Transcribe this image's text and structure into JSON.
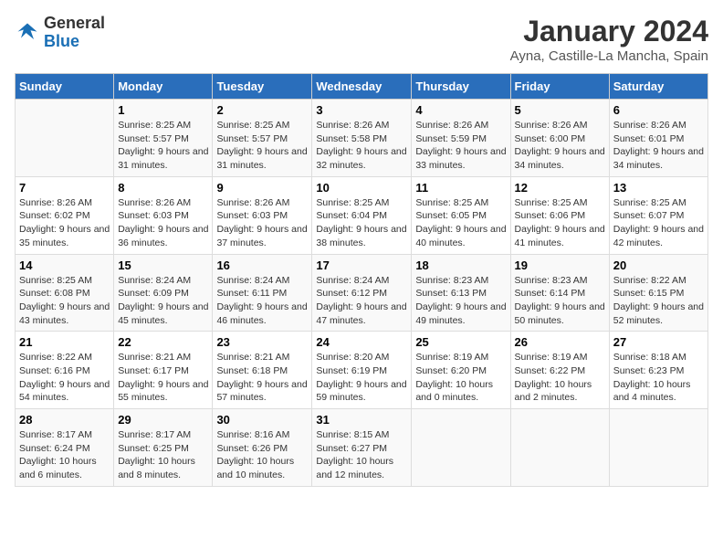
{
  "logo": {
    "general": "General",
    "blue": "Blue"
  },
  "title": "January 2024",
  "subtitle": "Ayna, Castille-La Mancha, Spain",
  "days_of_week": [
    "Sunday",
    "Monday",
    "Tuesday",
    "Wednesday",
    "Thursday",
    "Friday",
    "Saturday"
  ],
  "weeks": [
    [
      {
        "day": "",
        "info": ""
      },
      {
        "day": "1",
        "info": "Sunrise: 8:25 AM\nSunset: 5:57 PM\nDaylight: 9 hours and 31 minutes."
      },
      {
        "day": "2",
        "info": "Sunrise: 8:25 AM\nSunset: 5:57 PM\nDaylight: 9 hours and 31 minutes."
      },
      {
        "day": "3",
        "info": "Sunrise: 8:26 AM\nSunset: 5:58 PM\nDaylight: 9 hours and 32 minutes."
      },
      {
        "day": "4",
        "info": "Sunrise: 8:26 AM\nSunset: 5:59 PM\nDaylight: 9 hours and 33 minutes."
      },
      {
        "day": "5",
        "info": "Sunrise: 8:26 AM\nSunset: 6:00 PM\nDaylight: 9 hours and 34 minutes."
      },
      {
        "day": "6",
        "info": "Sunrise: 8:26 AM\nSunset: 6:01 PM\nDaylight: 9 hours and 34 minutes."
      }
    ],
    [
      {
        "day": "7",
        "info": "Sunrise: 8:26 AM\nSunset: 6:02 PM\nDaylight: 9 hours and 35 minutes."
      },
      {
        "day": "8",
        "info": "Sunrise: 8:26 AM\nSunset: 6:03 PM\nDaylight: 9 hours and 36 minutes."
      },
      {
        "day": "9",
        "info": "Sunrise: 8:26 AM\nSunset: 6:03 PM\nDaylight: 9 hours and 37 minutes."
      },
      {
        "day": "10",
        "info": "Sunrise: 8:25 AM\nSunset: 6:04 PM\nDaylight: 9 hours and 38 minutes."
      },
      {
        "day": "11",
        "info": "Sunrise: 8:25 AM\nSunset: 6:05 PM\nDaylight: 9 hours and 40 minutes."
      },
      {
        "day": "12",
        "info": "Sunrise: 8:25 AM\nSunset: 6:06 PM\nDaylight: 9 hours and 41 minutes."
      },
      {
        "day": "13",
        "info": "Sunrise: 8:25 AM\nSunset: 6:07 PM\nDaylight: 9 hours and 42 minutes."
      }
    ],
    [
      {
        "day": "14",
        "info": "Sunrise: 8:25 AM\nSunset: 6:08 PM\nDaylight: 9 hours and 43 minutes."
      },
      {
        "day": "15",
        "info": "Sunrise: 8:24 AM\nSunset: 6:09 PM\nDaylight: 9 hours and 45 minutes."
      },
      {
        "day": "16",
        "info": "Sunrise: 8:24 AM\nSunset: 6:11 PM\nDaylight: 9 hours and 46 minutes."
      },
      {
        "day": "17",
        "info": "Sunrise: 8:24 AM\nSunset: 6:12 PM\nDaylight: 9 hours and 47 minutes."
      },
      {
        "day": "18",
        "info": "Sunrise: 8:23 AM\nSunset: 6:13 PM\nDaylight: 9 hours and 49 minutes."
      },
      {
        "day": "19",
        "info": "Sunrise: 8:23 AM\nSunset: 6:14 PM\nDaylight: 9 hours and 50 minutes."
      },
      {
        "day": "20",
        "info": "Sunrise: 8:22 AM\nSunset: 6:15 PM\nDaylight: 9 hours and 52 minutes."
      }
    ],
    [
      {
        "day": "21",
        "info": "Sunrise: 8:22 AM\nSunset: 6:16 PM\nDaylight: 9 hours and 54 minutes."
      },
      {
        "day": "22",
        "info": "Sunrise: 8:21 AM\nSunset: 6:17 PM\nDaylight: 9 hours and 55 minutes."
      },
      {
        "day": "23",
        "info": "Sunrise: 8:21 AM\nSunset: 6:18 PM\nDaylight: 9 hours and 57 minutes."
      },
      {
        "day": "24",
        "info": "Sunrise: 8:20 AM\nSunset: 6:19 PM\nDaylight: 9 hours and 59 minutes."
      },
      {
        "day": "25",
        "info": "Sunrise: 8:19 AM\nSunset: 6:20 PM\nDaylight: 10 hours and 0 minutes."
      },
      {
        "day": "26",
        "info": "Sunrise: 8:19 AM\nSunset: 6:22 PM\nDaylight: 10 hours and 2 minutes."
      },
      {
        "day": "27",
        "info": "Sunrise: 8:18 AM\nSunset: 6:23 PM\nDaylight: 10 hours and 4 minutes."
      }
    ],
    [
      {
        "day": "28",
        "info": "Sunrise: 8:17 AM\nSunset: 6:24 PM\nDaylight: 10 hours and 6 minutes."
      },
      {
        "day": "29",
        "info": "Sunrise: 8:17 AM\nSunset: 6:25 PM\nDaylight: 10 hours and 8 minutes."
      },
      {
        "day": "30",
        "info": "Sunrise: 8:16 AM\nSunset: 6:26 PM\nDaylight: 10 hours and 10 minutes."
      },
      {
        "day": "31",
        "info": "Sunrise: 8:15 AM\nSunset: 6:27 PM\nDaylight: 10 hours and 12 minutes."
      },
      {
        "day": "",
        "info": ""
      },
      {
        "day": "",
        "info": ""
      },
      {
        "day": "",
        "info": ""
      }
    ]
  ]
}
